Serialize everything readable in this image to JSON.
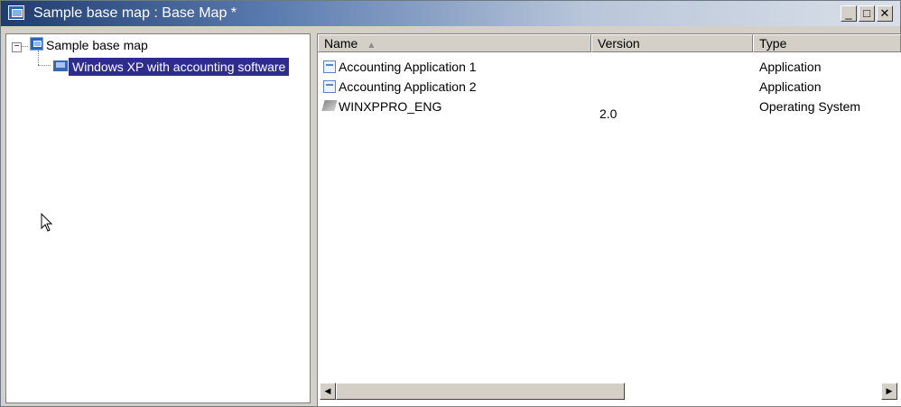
{
  "window": {
    "title": "Sample base map : Base Map *",
    "controls": {
      "minimize": "_",
      "maximize": "□",
      "close": "✕"
    }
  },
  "tree": {
    "root": {
      "label": "Sample base map",
      "toggle": "−",
      "icon": "base-map-icon"
    },
    "children": [
      {
        "label": "Windows XP with accounting software",
        "icon": "computer-icon",
        "selected": true
      }
    ]
  },
  "table": {
    "columns": [
      {
        "label": "Name",
        "sort": "ascending"
      },
      {
        "label": "Version"
      },
      {
        "label": "Type"
      }
    ],
    "rows": [
      {
        "name": "Accounting Application 1",
        "version": "",
        "type": "Application",
        "icon": "application-icon"
      },
      {
        "name": "Accounting Application 2",
        "version": "",
        "type": "Application",
        "icon": "application-icon"
      },
      {
        "name": "WINXPPRO_ENG",
        "version": "2.0",
        "type": "Operating System",
        "icon": "operating-system-icon"
      }
    ]
  },
  "scrollbar": {
    "left_arrow": "◀",
    "right_arrow": "▶"
  },
  "colors": {
    "selection": "#2f2c8f",
    "title_start": "#1f3c6e",
    "chrome": "#d4d0c8"
  }
}
